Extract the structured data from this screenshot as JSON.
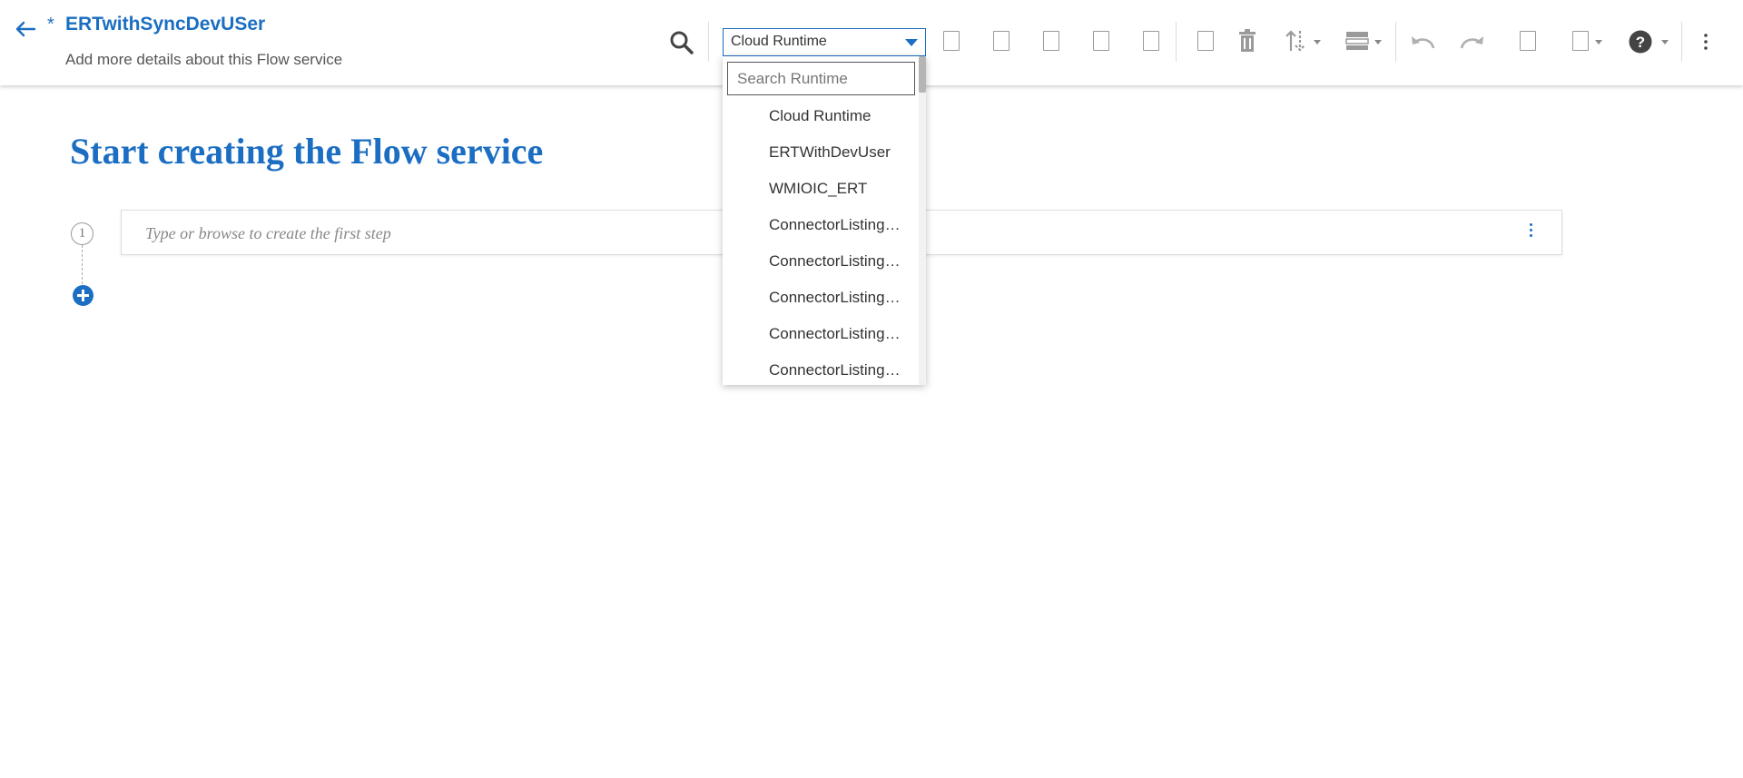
{
  "header": {
    "unsaved_marker": "*",
    "title": "ERTwithSyncDevUSer",
    "description": "Add more details about this Flow service"
  },
  "toolbar": {
    "runtime_selected": "Cloud Runtime",
    "icons": {
      "back": "back-arrow-icon",
      "search": "search-icon",
      "delete": "trash-icon",
      "sort": "sort-arrows-icon",
      "layout": "layout-icon",
      "undo": "undo-icon",
      "redo": "redo-icon",
      "help": "help-icon",
      "more": "more-vertical-icon"
    }
  },
  "runtime_dropdown": {
    "search_placeholder": "Search Runtime",
    "options": [
      "Cloud Runtime",
      "ERTWithDevUser",
      "WMIOIC_ERT",
      "ConnectorListing…",
      "ConnectorListing…",
      "ConnectorListing…",
      "ConnectorListing…",
      "ConnectorListing…"
    ]
  },
  "main": {
    "title": "Start creating the Flow service",
    "step_number": "1",
    "step_placeholder": "Type or browse to create the first step"
  },
  "colors": {
    "accent": "#1b6ec2",
    "icon_gray": "#9a9a9a"
  }
}
